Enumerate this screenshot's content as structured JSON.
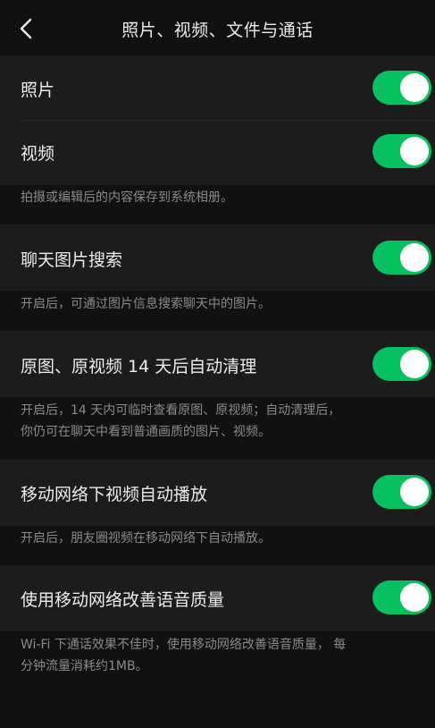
{
  "header": {
    "title": "照片、视频、文件与通话",
    "back_icon": "chevron-left-icon"
  },
  "colors": {
    "background": "#111111",
    "cell": "#1c1c1c",
    "toggle_on": "#07c160",
    "note_text": "#8a8a8a"
  },
  "settings": {
    "photo": {
      "label": "照片",
      "enabled": true
    },
    "video": {
      "label": "视频",
      "enabled": true
    },
    "save_note": "拍摄或编辑后的内容保存到系统相册。",
    "chat_image_search": {
      "label": "聊天图片搜索",
      "enabled": true
    },
    "chat_image_search_note": "开启后，可通过图片信息搜索聊天中的图片。",
    "auto_clean": {
      "label": "原图、原视频 14 天后自动清理",
      "enabled": true
    },
    "auto_clean_note_line1": "开启后，14 天内可临时查看原图、原视频；自动清理后，",
    "auto_clean_note_line2": "你仍可在聊天中看到普通画质的图片、视频。",
    "mobile_autoplay": {
      "label": "移动网络下视频自动播放",
      "enabled": true
    },
    "mobile_autoplay_note": "开启后，朋友圈视频在移动网络下自动播放。",
    "voice_quality": {
      "label": "使用移动网络改善语音质量",
      "enabled": true
    },
    "voice_quality_note_line1": "Wi-Fi 下通话效果不佳时，使用移动网络改善语音质量， 每",
    "voice_quality_note_line2": "分钟流量消耗约1MB。"
  }
}
